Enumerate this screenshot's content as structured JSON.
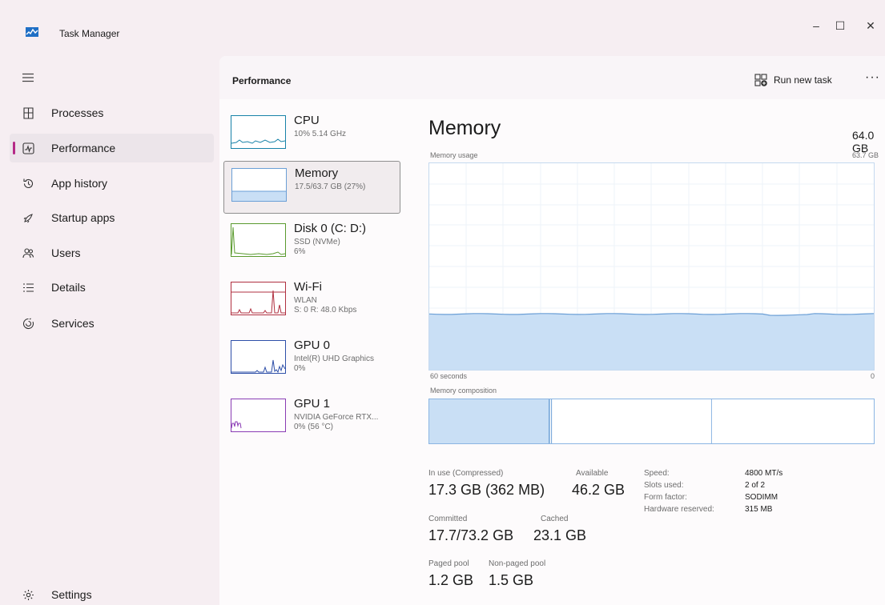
{
  "window": {
    "title": "Task Manager",
    "controls": {
      "minimize": "–",
      "maximize": "☐",
      "close": "✕"
    }
  },
  "sidebar": {
    "menu_icon": "hamburger-icon",
    "items": [
      {
        "label": "Processes",
        "icon": "processes-icon",
        "active": false
      },
      {
        "label": "Performance",
        "icon": "performance-icon",
        "active": true
      },
      {
        "label": "App history",
        "icon": "history-icon",
        "active": false
      },
      {
        "label": "Startup apps",
        "icon": "startup-icon",
        "active": false
      },
      {
        "label": "Users",
        "icon": "users-icon",
        "active": false
      },
      {
        "label": "Details",
        "icon": "details-icon",
        "active": false
      },
      {
        "label": "Services",
        "icon": "services-icon",
        "active": false
      }
    ],
    "settings": {
      "label": "Settings",
      "icon": "gear-icon"
    }
  },
  "header": {
    "title": "Performance",
    "run_new_task": "Run new task",
    "more": "···"
  },
  "resources": [
    {
      "name": "CPU",
      "lines": [
        "10% 5.14 GHz"
      ],
      "color": "#1782a8",
      "selected": false
    },
    {
      "name": "Memory",
      "lines": [
        "17.5/63.7 GB (27%)"
      ],
      "color": "#6b9fd6",
      "selected": true
    },
    {
      "name": "Disk 0 (C: D:)",
      "lines": [
        "SSD (NVMe)",
        "6%"
      ],
      "color": "#5a9a2e",
      "selected": false
    },
    {
      "name": "Wi-Fi",
      "lines": [
        "WLAN",
        "S: 0 R: 48.0 Kbps"
      ],
      "color": "#b03040",
      "selected": false
    },
    {
      "name": "GPU 0",
      "lines": [
        "Intel(R) UHD Graphics",
        "0%"
      ],
      "color": "#2e4fa8",
      "selected": false
    },
    {
      "name": "GPU 1",
      "lines": [
        "NVIDIA GeForce RTX...",
        "0% (56 °C)"
      ],
      "color": "#8a3cb4",
      "selected": false
    }
  ],
  "memory": {
    "title": "Memory",
    "total": "64.0 GB",
    "usage_label": "Memory usage",
    "usage_max": "63.7 GB",
    "time_left": "60 seconds",
    "time_right": "0",
    "composition_label": "Memory composition",
    "usage_fraction": 0.27,
    "composition": {
      "in_use": 0.27,
      "modified": 0.005,
      "standby": 0.36
    },
    "stats": {
      "in_use_label": "In use (Compressed)",
      "in_use_value": "17.3 GB (362 MB)",
      "available_label": "Available",
      "available_value": "46.2 GB",
      "committed_label": "Committed",
      "committed_value": "17.7/73.2 GB",
      "cached_label": "Cached",
      "cached_value": "23.1 GB",
      "paged_label": "Paged pool",
      "paged_value": "1.2 GB",
      "nonpaged_label": "Non-paged pool",
      "nonpaged_value": "1.5 GB"
    },
    "specs": [
      {
        "label": "Speed:",
        "value": "4800 MT/s"
      },
      {
        "label": "Slots used:",
        "value": "2 of 2"
      },
      {
        "label": "Form factor:",
        "value": "SODIMM"
      },
      {
        "label": "Hardware reserved:",
        "value": "315 MB"
      }
    ]
  },
  "colors": {
    "accent": "#b52a87",
    "memory_fill": "#c9dff5",
    "memory_line": "#6b9fd6"
  }
}
